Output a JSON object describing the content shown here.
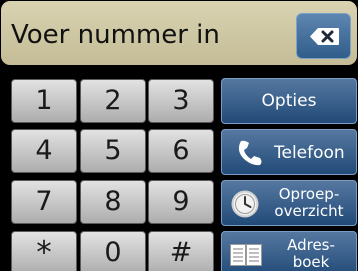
{
  "display": {
    "text": "Voer nummer in"
  },
  "keypad": [
    "1",
    "2",
    "3",
    "4",
    "5",
    "6",
    "7",
    "8",
    "9",
    "*",
    "0",
    "#"
  ],
  "buttons": {
    "options": "Opties",
    "phone": "Telefoon",
    "call_history_line1": "Oproep-",
    "call_history_line2": "overzicht",
    "address_book_line1": "Adres-",
    "address_book_line2": "boek"
  },
  "icons": {
    "backspace": "backspace-icon",
    "phone": "phone-icon",
    "clock": "clock-icon",
    "book": "address-book-icon"
  },
  "colors": {
    "display_bg": "#cfc8a5",
    "button_blue": "#2f5d8a",
    "key_gray": "#c8c8c8"
  }
}
